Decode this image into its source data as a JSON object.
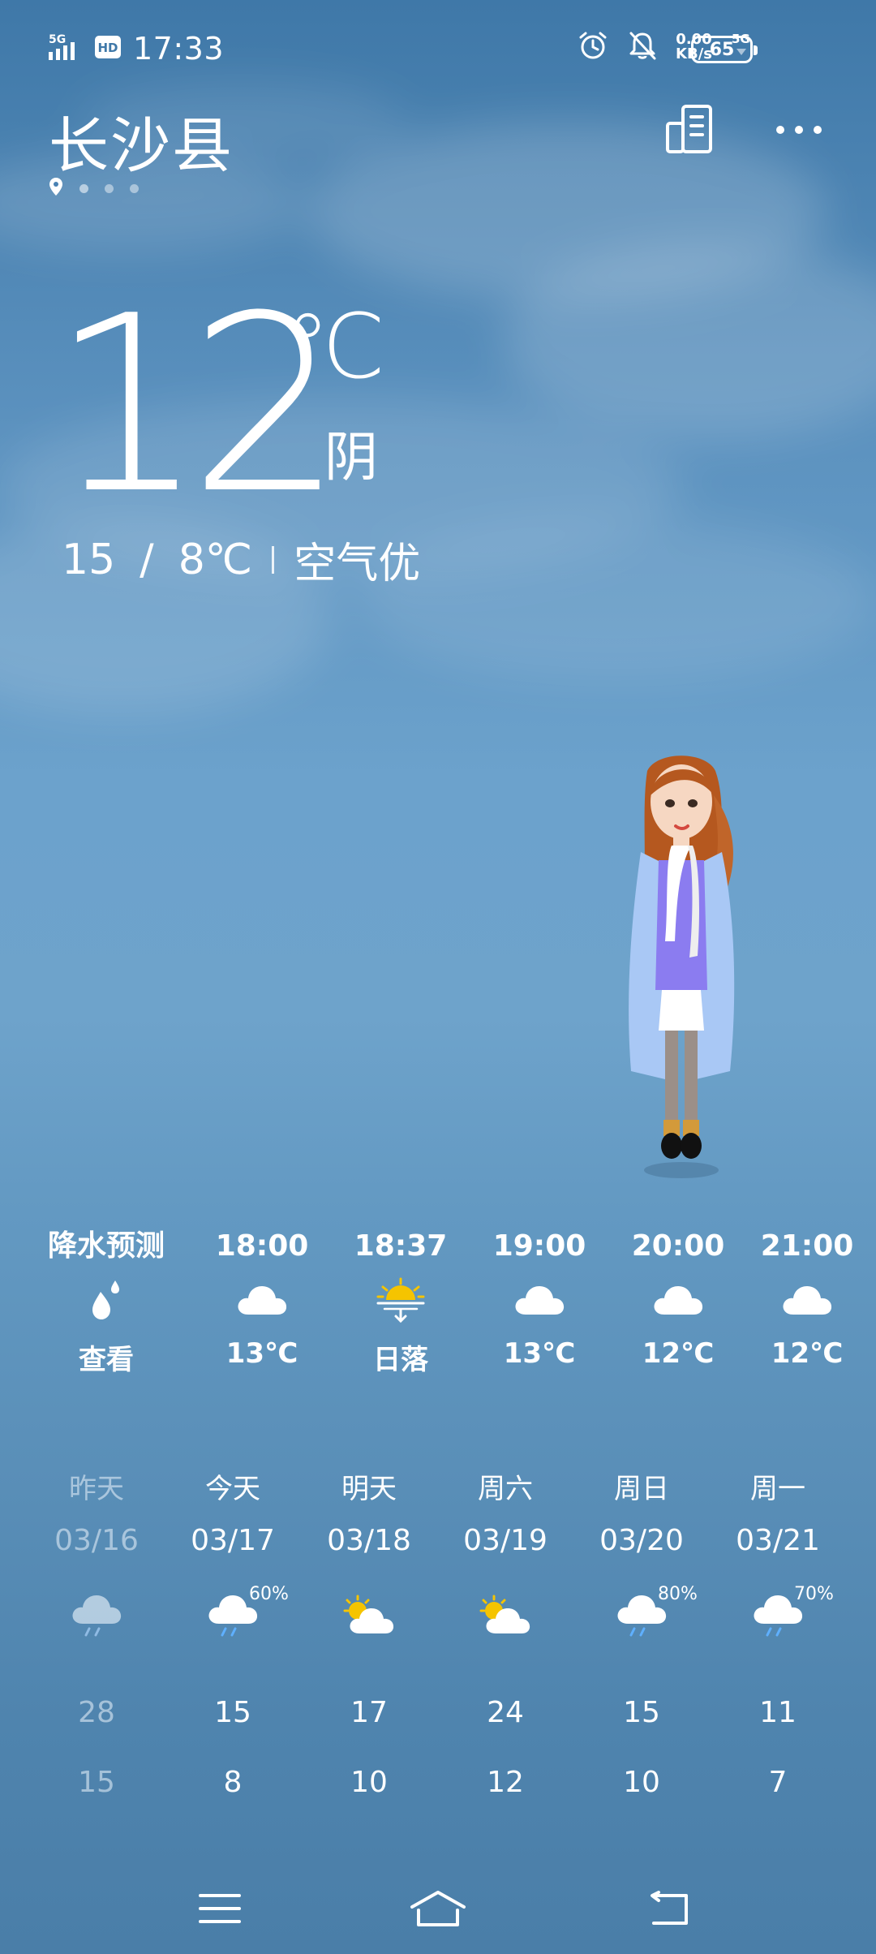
{
  "status_bar": {
    "time": "17:33",
    "signal_label": "5G",
    "hd_label": "HD",
    "network_label": "5G",
    "net_speed_value": "0.00",
    "net_speed_unit": "KB/s",
    "battery": "65",
    "icons": [
      "signal-icon",
      "hd-icon",
      "alarm-icon",
      "mute-icon",
      "battery-icon"
    ]
  },
  "header": {
    "city": "长沙县",
    "page_count": 4,
    "active_page": 0,
    "icons": [
      "location-pin-icon",
      "city-manage-icon",
      "more-icon"
    ]
  },
  "current": {
    "temperature": "12",
    "unit": "℃",
    "condition": "阴",
    "high": "15",
    "range_sep": "/",
    "low_with_unit": "8℃",
    "air_quality": "空气优"
  },
  "hourly": [
    {
      "label": "降水预测",
      "icon": "raindrop-icon",
      "value": "查看"
    },
    {
      "label": "18:00",
      "icon": "cloud-icon",
      "value": "13℃"
    },
    {
      "label": "18:37",
      "icon": "sunset-icon",
      "value": "日落"
    },
    {
      "label": "19:00",
      "icon": "cloud-icon",
      "value": "13℃"
    },
    {
      "label": "20:00",
      "icon": "cloud-icon",
      "value": "12℃"
    },
    {
      "label": "21:00",
      "icon": "cloud-icon",
      "value": "12℃"
    }
  ],
  "daily": [
    {
      "day": "昨天",
      "date": "03/16",
      "icon": "rain-cloud-icon",
      "pop": "",
      "high": "28",
      "low": "15",
      "past": true
    },
    {
      "day": "今天",
      "date": "03/17",
      "icon": "rain-cloud-icon",
      "pop": "60%",
      "high": "15",
      "low": "8",
      "past": false
    },
    {
      "day": "明天",
      "date": "03/18",
      "icon": "partly-cloudy-icon",
      "pop": "",
      "high": "17",
      "low": "10",
      "past": false
    },
    {
      "day": "周六",
      "date": "03/19",
      "icon": "partly-cloudy-icon",
      "pop": "",
      "high": "24",
      "low": "12",
      "past": false
    },
    {
      "day": "周日",
      "date": "03/20",
      "icon": "rain-cloud-icon",
      "pop": "80%",
      "high": "15",
      "low": "10",
      "past": false
    },
    {
      "day": "周一",
      "date": "03/21",
      "icon": "rain-cloud-icon",
      "pop": "70%",
      "high": "11",
      "low": "7",
      "past": false
    }
  ],
  "navbar": {
    "icons": [
      "menu-icon",
      "home-icon",
      "back-icon"
    ]
  },
  "colors": {
    "sky_top": "#3f78a8",
    "sky_mid": "#6ca2cc",
    "sky_bottom": "#4a7ea8",
    "sun_yellow": "#f5c400",
    "rain_blue": "#5fb0ff",
    "coat_blue": "#a9c8f5",
    "sweater_purple": "#8b7cf0"
  }
}
